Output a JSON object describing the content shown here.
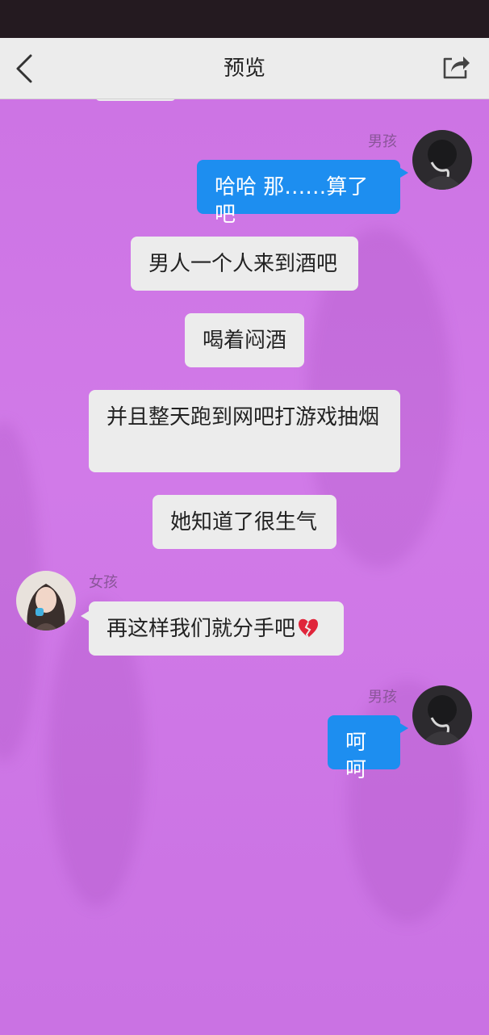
{
  "nav": {
    "title": "预览",
    "back_icon": "chevron-left-icon",
    "share_icon": "share-icon"
  },
  "colors": {
    "chat_background": "#cf77e6",
    "blue_bubble": "#1d8ef0",
    "gray_bubble": "#ececec"
  },
  "messages": [
    {
      "side": "right",
      "sender": "男孩",
      "text": "哈哈 那……算了吧",
      "style": "blue"
    },
    {
      "side": "center",
      "text": "男人一个人来到酒吧",
      "style": "gray"
    },
    {
      "side": "center",
      "text": "喝着闷酒",
      "style": "gray"
    },
    {
      "side": "center",
      "text": "并且整天跑到网吧打游戏抽烟",
      "style": "gray"
    },
    {
      "side": "center",
      "text": "她知道了很生气",
      "style": "gray"
    },
    {
      "side": "left",
      "sender": "女孩",
      "text": "再这样我们就分手吧",
      "emoji": "broken-heart-icon",
      "style": "gray"
    },
    {
      "side": "right",
      "sender": "男孩",
      "text": "呵呵",
      "style": "blue"
    }
  ]
}
